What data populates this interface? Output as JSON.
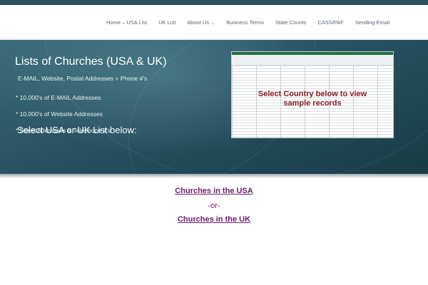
{
  "nav": {
    "items": [
      {
        "label": "Home – USA List"
      },
      {
        "label": "UK List"
      },
      {
        "label": "About Us",
        "has_dropdown": true
      },
      {
        "label": "Business Terms"
      },
      {
        "label": "State Counts"
      },
      {
        "label": "CASS/PAF"
      },
      {
        "label": "Sending Email"
      }
    ]
  },
  "hero": {
    "title": "Lists of Churches (USA & UK)",
    "subtitle": "E-MAIL, Website, Postal Addresses + Phone #'s",
    "bullets": [
      "* 10,000's of E-MAIL Addresses",
      "* 10,000's of Website Addresses",
      "* Street Addresses & Telephone #'s"
    ],
    "select_prompt": "Select USA or UK List below:",
    "image": {
      "overlay_line1": "Select Country below to view",
      "overlay_line2": "sample records"
    }
  },
  "links": {
    "usa": "Churches in the USA",
    "or": "-or-",
    "uk": "Churches in the UK"
  },
  "colors": {
    "hero_bg": "#2a5565",
    "link": "#6a1d6e",
    "overlay_text": "#8b1d1d"
  }
}
